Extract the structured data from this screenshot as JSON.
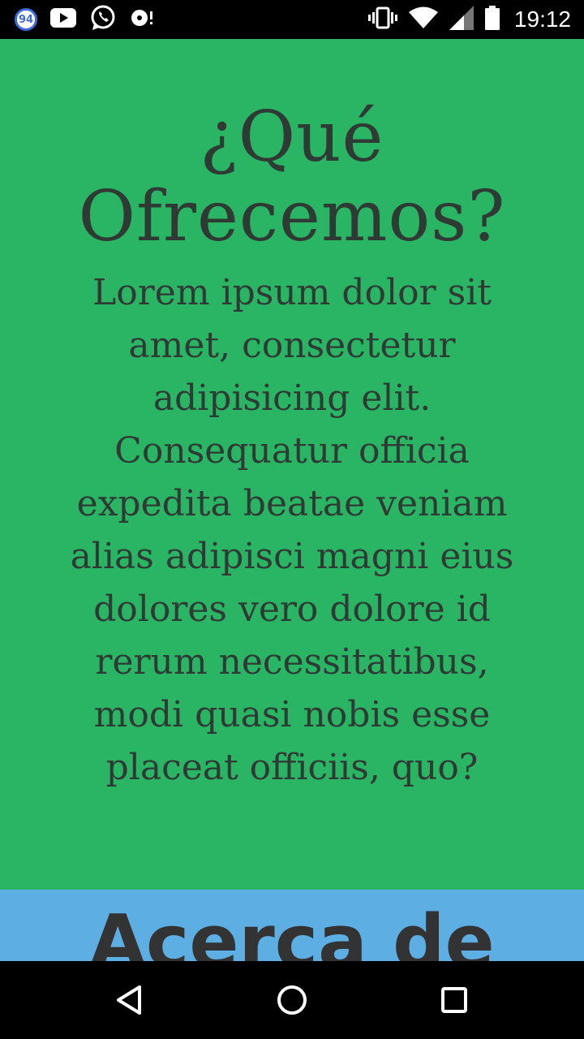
{
  "status_bar": {
    "notification_count": "94",
    "time": "19:12",
    "icons": [
      "notification-badge",
      "youtube-icon",
      "whatsapp-icon",
      "media-icon",
      "vibrate-icon",
      "wifi-icon",
      "signal-icon",
      "battery-icon"
    ]
  },
  "main": {
    "title": "¿Qué Ofrecemos?",
    "body": "Lorem ipsum dolor sit amet, consectetur adipisicing elit. Consequatur officia expedita beatae veniam alias adipisci magni eius dolores vero dolore id rerum necessitatibus, modi quasi nobis esse placeat officiis, quo?"
  },
  "next_section": {
    "title": "Acerca de"
  },
  "nav_bar": {
    "icons": [
      "back-icon",
      "home-icon",
      "recents-icon"
    ]
  },
  "colors": {
    "green_section": "#2ab564",
    "blue_section": "#5daee3",
    "text": "#2f3a35"
  }
}
